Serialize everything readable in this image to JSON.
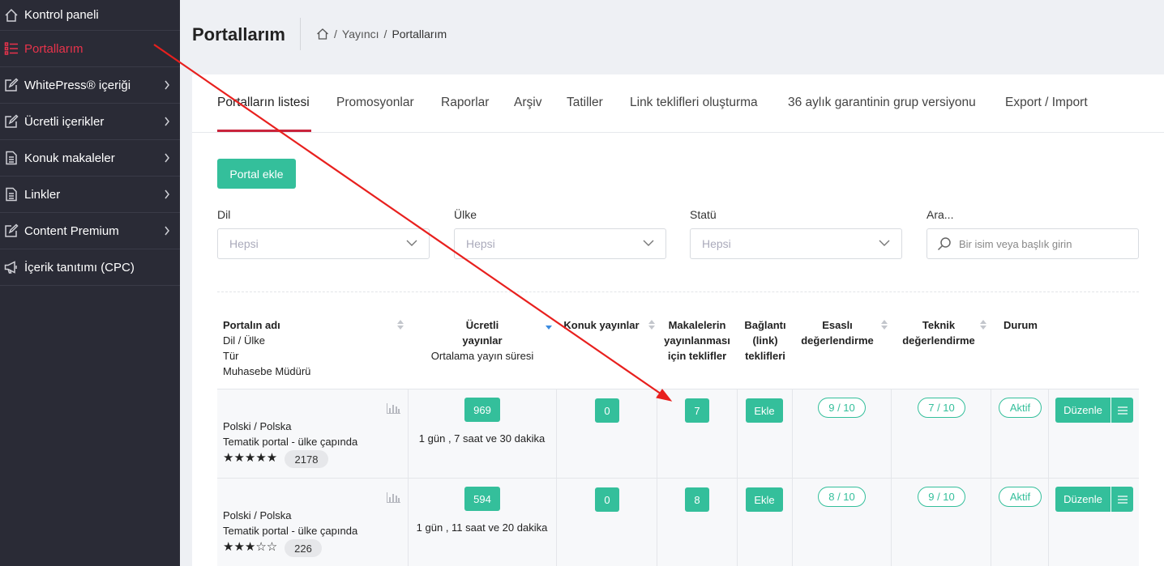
{
  "sidebar": {
    "items": [
      {
        "label": "Kontrol paneli",
        "icon": "home-icon",
        "chevron": false,
        "active": false
      },
      {
        "label": "Portallarım",
        "icon": "list-icon",
        "chevron": false,
        "active": true
      },
      {
        "label": "WhitePress® içeriği",
        "icon": "edit-icon",
        "chevron": true,
        "active": false
      },
      {
        "label": "Ücretli içerikler",
        "icon": "edit-icon",
        "chevron": true,
        "active": false
      },
      {
        "label": "Konuk makaleler",
        "icon": "document-icon",
        "chevron": true,
        "active": false
      },
      {
        "label": "Linkler",
        "icon": "document-icon",
        "chevron": true,
        "active": false
      },
      {
        "label": "Content Premium",
        "icon": "edit-icon",
        "chevron": true,
        "active": false
      },
      {
        "label": "İçerik tanıtımı (CPC)",
        "icon": "megaphone-icon",
        "chevron": false,
        "active": false
      }
    ]
  },
  "header": {
    "title": "Portallarım",
    "breadcrumb": [
      "Yayıncı",
      "Portallarım"
    ]
  },
  "tabs": [
    "Portalların listesi",
    "Promosyonlar",
    "Raporlar",
    "Arşiv",
    "Tatiller",
    "Link teklifleri oluşturma",
    "36 aylık garantinin grup versiyonu",
    "Export / Import"
  ],
  "add_button": "Portal ekle",
  "filters": {
    "lang_label": "Dil",
    "lang_value": "Hepsi",
    "country_label": "Ülke",
    "country_value": "Hepsi",
    "status_label": "Statü",
    "status_value": "Hepsi",
    "search_label": "Ara...",
    "search_placeholder": "Bir isim veya başlık girin"
  },
  "table": {
    "headers": {
      "portal": [
        "Portalın adı",
        "Dil / Ülke",
        "Tür",
        "Muhasebe Müdürü"
      ],
      "paid": [
        "Ücretli",
        "yayınlar",
        "Ortalama yayın süresi"
      ],
      "guest": "Konuk yayınlar",
      "offers": [
        "Makalelerin",
        "yayınlanması",
        "için teklifler"
      ],
      "links": [
        "Bağlantı",
        "(link)",
        "teklifleri"
      ],
      "content_rating": [
        "Esaslı",
        "değerlendirme"
      ],
      "tech_rating": [
        "Teknik",
        "değerlendirme"
      ],
      "status": "Durum"
    },
    "rows": [
      {
        "lang": "Polski / Polska",
        "type": "Tematik portal - ülke çapında",
        "stars": "★★★★★",
        "reviews": "2178",
        "paid": "969",
        "avg_time": "1 gün , 7 saat ve 30 dakika",
        "guest": "0",
        "offers": "7",
        "links": "Ekle",
        "content_rating": "9 / 10",
        "tech_rating": "7 / 10",
        "status": "Aktif",
        "edit": "Düzenle"
      },
      {
        "lang": "Polski / Polska",
        "type": "Tematik portal - ülke çapında",
        "stars": "★★★☆☆",
        "reviews": "226",
        "paid": "594",
        "avg_time": "1 gün , 11 saat ve 20 dakika",
        "guest": "0",
        "offers": "8",
        "links": "Ekle",
        "content_rating": "8 / 10",
        "tech_rating": "9 / 10",
        "status": "Aktif",
        "edit": "Düzenle"
      }
    ]
  },
  "colors": {
    "accent": "#34bf9b",
    "active_red": "#e8334b",
    "sidebar_bg": "#2a2b36",
    "arrow": "#e8201e"
  }
}
